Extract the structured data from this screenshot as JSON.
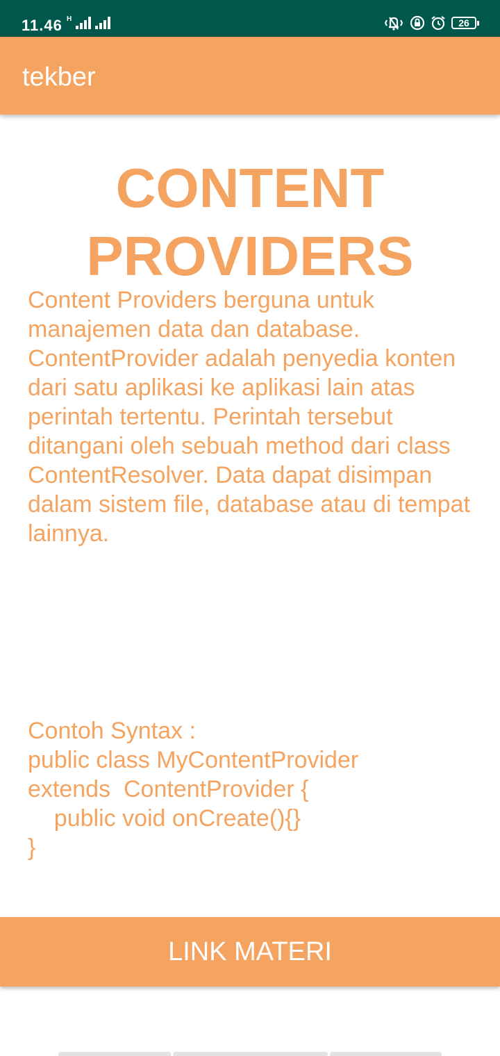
{
  "status_bar": {
    "time": "11.46",
    "network_type": "H",
    "battery_level": "26",
    "icons": [
      "signal-icon",
      "signal-icon",
      "vibrate-icon",
      "lock-rotation-icon",
      "alarm-icon",
      "battery-icon"
    ],
    "background_color": "#00574b"
  },
  "app_bar": {
    "title": "tekber",
    "background_color": "#f4a460"
  },
  "content": {
    "heading": "CONTENT PROVIDERS",
    "description": "Content Providers berguna untuk manajemen data dan database. ContentProvider adalah penyedia konten dari satu aplikasi ke aplikasi lain atas perintah tertentu. Perintah tersebut ditangani oleh sebuah method dari class ContentResolver. Data dapat disimpan dalam sistem file, database atau di tempat lainnya.",
    "code_example": "Contoh Syntax :\npublic class MyContentProvider\nextends  ContentProvider {\n    public void onCreate(){}\n}",
    "text_color": "#f4a460"
  },
  "actions": {
    "link_button_label": "LINK MATERI",
    "button_color": "#f4a460"
  }
}
